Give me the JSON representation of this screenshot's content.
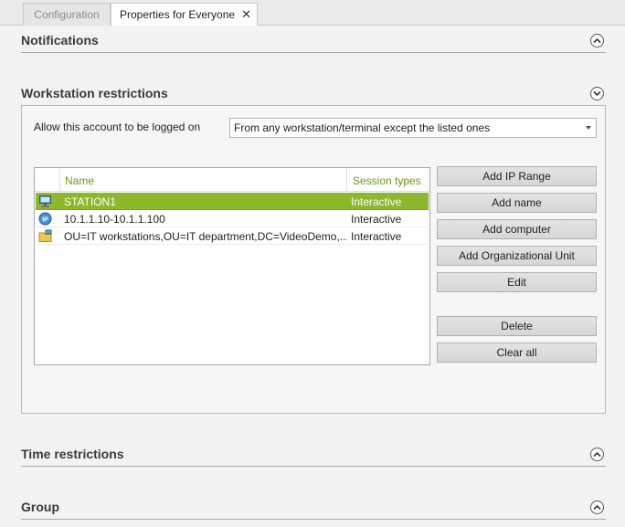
{
  "tabs": [
    {
      "label": "Configuration",
      "active": false
    },
    {
      "label": "Properties for Everyone",
      "active": true,
      "close_glyph": "✕"
    }
  ],
  "sections": {
    "notifications": {
      "title": "Notifications",
      "state": "collapsed"
    },
    "workstation": {
      "title": "Workstation restrictions",
      "state": "expanded"
    },
    "time": {
      "title": "Time restrictions",
      "state": "collapsed"
    },
    "group": {
      "title": "Group",
      "state": "collapsed"
    }
  },
  "workstation": {
    "allow_label": "Allow this account to be logged on",
    "allow_value": "From any workstation/terminal except the listed ones",
    "columns": {
      "name": "Name",
      "session": "Session types"
    },
    "rows": [
      {
        "icon": "workstation-icon",
        "name": "STATION1",
        "session": "Interactive",
        "selected": true
      },
      {
        "icon": "ip-icon",
        "name": "10.1.1.10-10.1.1.100",
        "session": "Interactive",
        "selected": false
      },
      {
        "icon": "organizational-unit-icon",
        "name": "OU=IT workstations,OU=IT department,DC=VideoDemo,...",
        "session": "Interactive",
        "selected": false
      }
    ],
    "buttons": {
      "add_ip_range": "Add IP Range",
      "add_name": "Add name",
      "add_computer": "Add computer",
      "add_ou": "Add Organizational Unit",
      "edit": "Edit",
      "delete": "Delete",
      "clear_all": "Clear all"
    }
  },
  "colors": {
    "accent": "#8db82b",
    "header_text": "#6a9a1c"
  }
}
